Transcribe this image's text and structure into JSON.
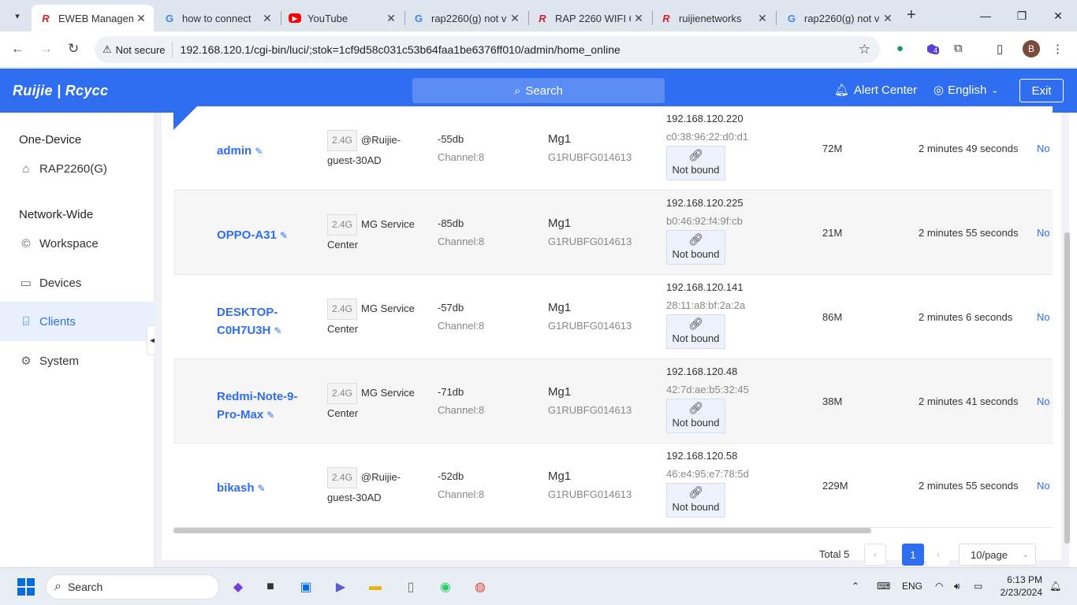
{
  "browser": {
    "tabs": [
      {
        "title": "EWEB Managem",
        "favicon": "ruijie-logo",
        "active": true
      },
      {
        "title": "how to connect",
        "favicon": "google-logo"
      },
      {
        "title": "YouTube",
        "favicon": "youtube-logo"
      },
      {
        "title": "rap2260(g) not v",
        "favicon": "google-logo"
      },
      {
        "title": "RAP 2260 WIFI 6",
        "favicon": "ruijie-logo"
      },
      {
        "title": "ruijienetworks",
        "favicon": "ruijie-logo"
      },
      {
        "title": "rap2260(g) not v",
        "favicon": "google-logo"
      }
    ],
    "security_label": "Not secure",
    "url": "192.168.120.1/cgi-bin/luci/;stok=1cf9d58c031c53b64faa1be6376ff010/admin/home_online",
    "profile_initial": "B",
    "extension_badge": "4"
  },
  "header": {
    "logo": "Ruijie | Rcycc",
    "search_label": "Search",
    "alert_label": "Alert Center",
    "language_label": "English",
    "exit_label": "Exit"
  },
  "sidebar": {
    "section1": "One-Device",
    "device": "RAP2260(G)",
    "section2": "Network-Wide",
    "items": [
      {
        "label": "Workspace",
        "icon": "workspace-icon"
      },
      {
        "label": "Devices",
        "icon": "devices-icon"
      },
      {
        "label": "Clients",
        "icon": "clients-icon",
        "active": true
      },
      {
        "label": "System",
        "icon": "system-icon"
      }
    ]
  },
  "clients": [
    {
      "name": "admin",
      "band": "2.4G",
      "ssid": "@Ruijie-guest-30AD",
      "signal": "-55db",
      "channel": "Channel:8",
      "ap": "Mg1",
      "serial": "G1RUBFG014613",
      "ip": "192.168.120.220",
      "mac": "c0:38:96:22:d0:d1",
      "bind": "Not bound",
      "rate": "72M",
      "duration": "2 minutes 49 seconds",
      "more": "No"
    },
    {
      "name": "OPPO-A31",
      "band": "2.4G",
      "ssid": "MG Service Center",
      "signal": "-85db",
      "channel": "Channel:8",
      "ap": "Mg1",
      "serial": "G1RUBFG014613",
      "ip": "192.168.120.225",
      "mac": "b0:46:92:f4:9f:cb",
      "bind": "Not bound",
      "rate": "21M",
      "duration": "2 minutes 55 seconds",
      "more": "No"
    },
    {
      "name": "DESKTOP-C0H7U3H",
      "band": "2.4G",
      "ssid": "MG Service Center",
      "signal": "-57db",
      "channel": "Channel:8",
      "ap": "Mg1",
      "serial": "G1RUBFG014613",
      "ip": "192.168.120.141",
      "mac": "28:11:a8:bf:2a:2a",
      "bind": "Not bound",
      "rate": "86M",
      "duration": "2 minutes 6 seconds",
      "more": "No"
    },
    {
      "name": "Redmi-Note-9-Pro-Max",
      "band": "2.4G",
      "ssid": "MG Service Center",
      "signal": "-71db",
      "channel": "Channel:8",
      "ap": "Mg1",
      "serial": "G1RUBFG014613",
      "ip": "192.168.120.48",
      "mac": "42:7d:ae:b5:32:45",
      "bind": "Not bound",
      "rate": "38M",
      "duration": "2 minutes 41 seconds",
      "more": "No"
    },
    {
      "name": "bikash",
      "band": "2.4G",
      "ssid": "@Ruijie-guest-30AD",
      "signal": "-52db",
      "channel": "Channel:8",
      "ap": "Mg1",
      "serial": "G1RUBFG014613",
      "ip": "192.168.120.58",
      "mac": "46:e4:95:e7:78:5d",
      "bind": "Not bound",
      "rate": "229M",
      "duration": "2 minutes 55 seconds",
      "more": "No"
    }
  ],
  "pagination": {
    "total": "Total 5",
    "current": "1",
    "page_size": "10/page"
  },
  "taskbar": {
    "search_label": "Search",
    "language": "ENG",
    "time": "6:13 PM",
    "date": "2/23/2024"
  },
  "colors": {
    "accent": "#2f6ef0",
    "header_bg": "#2f6ef0"
  }
}
